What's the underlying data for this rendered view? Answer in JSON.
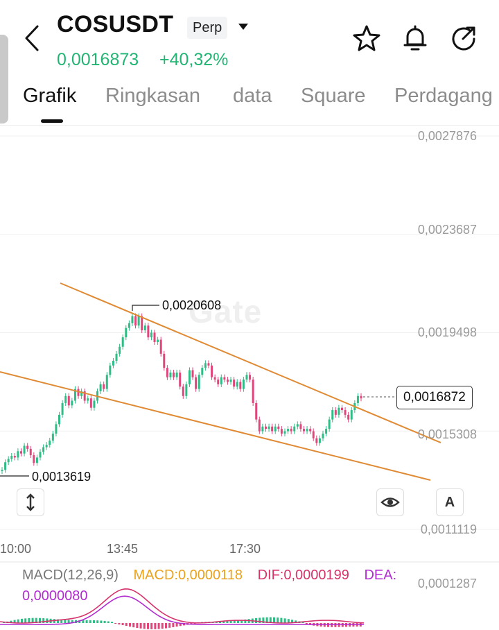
{
  "header": {
    "symbol": "COSUSDT",
    "contract_type": "Perp",
    "last_price": "0,0016873",
    "change_pct": "+40,32%",
    "icons": [
      "back-arrow-icon",
      "star-icon",
      "bell-icon",
      "share-icon"
    ]
  },
  "tabs": [
    {
      "label": "Grafik",
      "active": true
    },
    {
      "label": "Ringkasan",
      "active": false
    },
    {
      "label": "data",
      "active": false
    },
    {
      "label": "Square",
      "active": false
    },
    {
      "label": "Perdagang",
      "active": false
    }
  ],
  "chart": {
    "watermark": "Gate",
    "y_ticks": [
      "0,0027876",
      "0,0023687",
      "0,0019498",
      "0,0015308",
      "0,0011119"
    ],
    "x_ticks": [
      "10:00",
      "13:45",
      "17:30"
    ],
    "high_annotation": "0,0020608",
    "low_annotation": "0,0013619",
    "current_price_tag": "0,0016872",
    "colors": {
      "up": "#2ebd85",
      "down": "#e0457b",
      "trendline": "#e08a34",
      "grid": "#f0f0f0"
    }
  },
  "chart_data": {
    "type": "candlestick",
    "x_ticks": [
      "10:00",
      "13:45",
      "17:30"
    ],
    "ylim": [
      0.0011119,
      0.0027876
    ],
    "y_ticks": [
      0.0027876,
      0.0023687,
      0.0019498,
      0.0015308,
      0.0011119
    ],
    "annotations": {
      "high": 0.0020608,
      "low": 0.0013619,
      "last": 0.0016872
    },
    "trendlines": "two descending lines (falling wedge)",
    "closes": [
      0.001365,
      0.001398,
      0.001412,
      0.001425,
      0.001418,
      0.001445,
      0.001435,
      0.001468,
      0.001455,
      0.001428,
      0.001395,
      0.001418,
      0.001442,
      0.001462,
      0.001472,
      0.00149,
      0.00152,
      0.00156,
      0.0016,
      0.00165,
      0.00168,
      0.00164,
      0.00166,
      0.00171,
      0.00168,
      0.0017,
      0.00166,
      0.00167,
      0.00163,
      0.00166,
      0.0017,
      0.00173,
      0.00171,
      0.00177,
      0.00181,
      0.00183,
      0.00186,
      0.00189,
      0.00193,
      0.00197,
      0.00199,
      0.00202,
      0.00198,
      0.00202,
      0.00196,
      0.00198,
      0.00193,
      0.00195,
      0.00191,
      0.00192,
      0.00186,
      0.0018,
      0.00176,
      0.00178,
      0.00176,
      0.00178,
      0.00172,
      0.00168,
      0.00173,
      0.00179,
      0.00176,
      0.00171,
      0.00177,
      0.0018,
      0.00182,
      0.00181,
      0.00176,
      0.00175,
      0.00173,
      0.00176,
      0.00175,
      0.00174,
      0.00175,
      0.00172,
      0.00174,
      0.00171,
      0.00175,
      0.00177,
      0.00175,
      0.00165,
      0.00158,
      0.00153,
      0.00155,
      0.00154,
      0.00155,
      0.00153,
      0.00155,
      0.00154,
      0.00152,
      0.00153,
      0.00154,
      0.00153,
      0.00155,
      0.00156,
      0.00154,
      0.00153,
      0.00154,
      0.00153,
      0.0015,
      0.00148,
      0.0015,
      0.00152,
      0.00154,
      0.00158,
      0.00162,
      0.0016,
      0.00163,
      0.00162,
      0.0016,
      0.00158,
      0.00162,
      0.00165,
      0.00168,
      0.00167
    ]
  },
  "toolbar": {
    "left_icon": "vertical-resize-icon",
    "eye_icon": "eye-icon",
    "auto_label": "A"
  },
  "macd": {
    "title": "MACD(12,26,9)",
    "macd_label": "MACD:0,0000118",
    "dif_label": "DIF:0,0000199",
    "dea_label": "DEA:",
    "dea_value": "0,0000080",
    "axis_value": "0,0001287",
    "colors": {
      "macd": "#e9a21c",
      "dif": "#d6336c",
      "dea": "#b12ccf"
    }
  }
}
